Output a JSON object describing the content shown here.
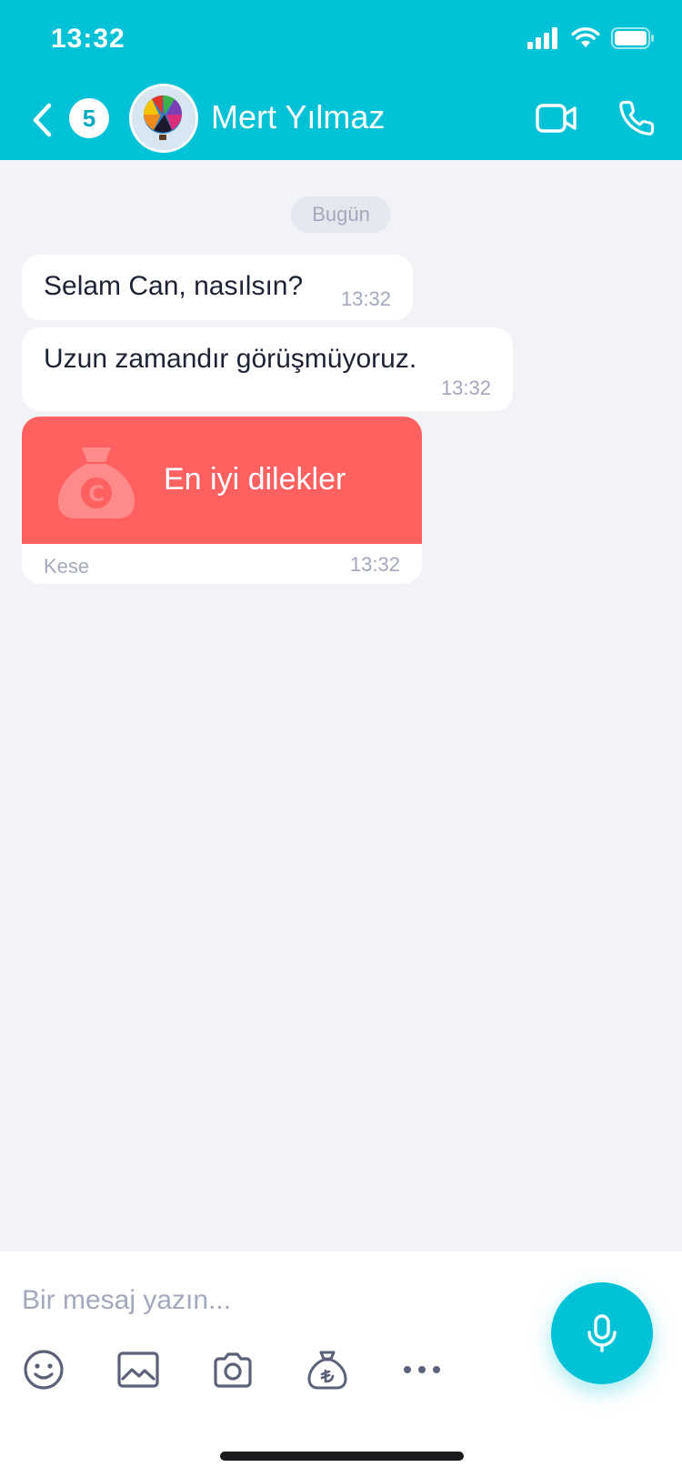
{
  "status_bar": {
    "time": "13:32",
    "icons": [
      "signal-icon",
      "wifi-icon",
      "battery-icon"
    ]
  },
  "header": {
    "back_icon": "chevron-left-icon",
    "unread_count": "5",
    "contact_name": "Mert Yılmaz",
    "avatar": "hot-air-balloon-avatar",
    "actions": [
      "video-camera-icon",
      "phone-icon"
    ]
  },
  "chat": {
    "date_label": "Bugün",
    "messages": [
      {
        "text": "Selam Can, nasılsın?",
        "time": "13:32"
      },
      {
        "text": "Uzun zamandır görüşmüyoruz.",
        "time": "13:32"
      }
    ],
    "gift": {
      "icon": "money-bag-icon",
      "title": "En iyi dilekler",
      "type": "Kese",
      "time": "13:32"
    }
  },
  "composer": {
    "placeholder": "Bir mesaj yazın...",
    "tools": [
      "emoji-icon",
      "gallery-icon",
      "camera-icon",
      "lira-bag-icon",
      "more-icon"
    ],
    "mic_icon": "microphone-icon"
  },
  "colors": {
    "brand": "#00c2d6",
    "gift": "#ff6161",
    "background": "#f2f3f7",
    "muted": "#a3a8bd"
  }
}
